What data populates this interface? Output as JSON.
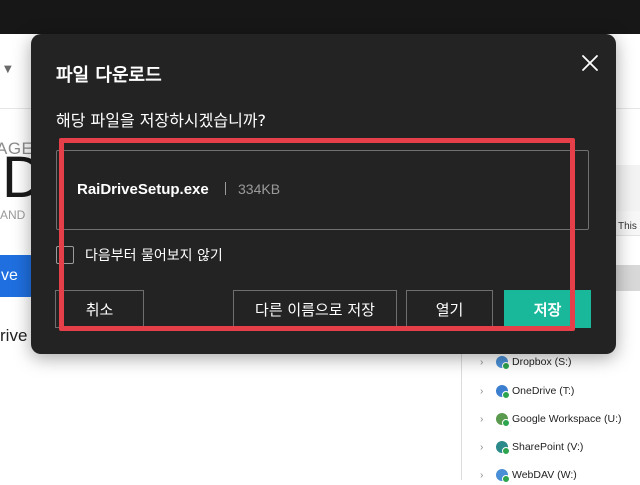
{
  "background": {
    "page_text_top": "AGE",
    "page_text_big": "D",
    "page_text_small": "AND",
    "blue_button_label": "ve",
    "drive_text": "rive",
    "explorer": {
      "tab_label": "This",
      "drives": [
        {
          "label": "Dropbox (S:)",
          "icon": "dropbox-drive-icon",
          "color": "#4a8fd6"
        },
        {
          "label": "OneDrive (T:)",
          "icon": "onedrive-drive-icon",
          "color": "#3c7fd1"
        },
        {
          "label": "Google Workspace (U:)",
          "icon": "google-drive-icon",
          "color": "#5a9a4e"
        },
        {
          "label": "SharePoint (V:)",
          "icon": "sharepoint-drive-icon",
          "color": "#2c8a8a"
        },
        {
          "label": "WebDAV (W:)",
          "icon": "webdav-drive-icon",
          "color": "#4a8fd6"
        }
      ]
    }
  },
  "dialog": {
    "title": "파일 다운로드",
    "question": "해당 파일을 저장하시겠습니까?",
    "file": {
      "name": "RaiDriveSetup.exe",
      "size": "334KB"
    },
    "checkbox_label": "다음부터 물어보지 않기",
    "buttons": {
      "cancel": "취소",
      "save_as": "다른 이름으로 저장",
      "open": "열기",
      "save": "저장"
    },
    "close_icon": "close-icon"
  },
  "colors": {
    "dialog_bg": "#232323",
    "save_button": "#19b89a",
    "highlight": "#e5404a",
    "blue_button": "#1f6fe0"
  }
}
